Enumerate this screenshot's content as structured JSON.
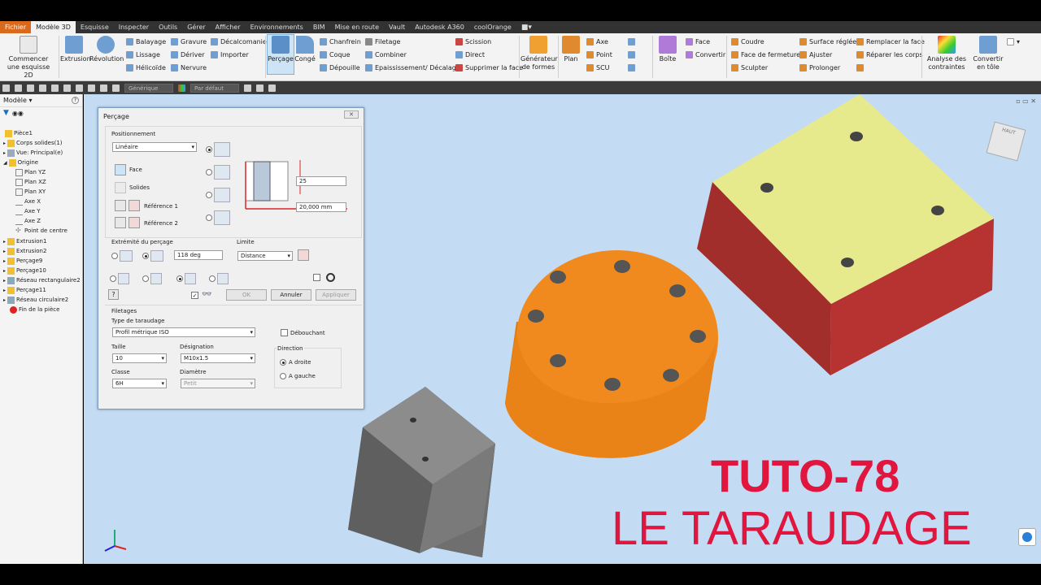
{
  "tabs": [
    "Fichier",
    "Modèle 3D",
    "Esquisse",
    "Inspecter",
    "Outils",
    "Gérer",
    "Afficher",
    "Environnements",
    "BIM",
    "Mise en route",
    "Vault",
    "Autodesk A360",
    "coolOrange"
  ],
  "ribbon": {
    "start_sketch": "Commencer une esquisse 2D",
    "extrusion": "Extrusion",
    "revolution": "Révolution",
    "balayage": "Balayage",
    "lissage": "Lissage",
    "helicoide": "Hélicoïde",
    "gravure": "Gravure",
    "deriver": "Dériver",
    "nervure": "Nervure",
    "decalcomanie": "Décalcomanie",
    "importer": "Importer",
    "percage": "Perçage",
    "conge": "Congé",
    "chanfrein": "Chanfrein",
    "coque": "Coque",
    "depouille": "Dépouille",
    "filetage": "Filetage",
    "combiner": "Combiner",
    "epaississement": "Epaississement/ Décalage",
    "scission": "Scission",
    "direct": "Direct",
    "supprimer_face": "Supprimer la face",
    "generateur_formes": "Générateur de formes",
    "plan": "Plan",
    "axe": "Axe",
    "point": "Point",
    "scu": "SCU",
    "boite": "Boîte",
    "face": "Face",
    "convertir": "Convertir",
    "coudre": "Coudre",
    "face_fermeture": "Face de fermeture",
    "sculpter": "Sculpter",
    "surface_reglee": "Surface réglée",
    "ajuster": "Ajuster",
    "prolonger": "Prolonger",
    "remplacer_face": "Remplacer la face",
    "reparer_corps": "Réparer les corps",
    "analyse_contraintes": "Analyse des contraintes",
    "convertir_tole": "Convertir en tôle"
  },
  "qat": {
    "material": "Générique",
    "appearance": "Par défaut"
  },
  "browser": {
    "header": "Modèle",
    "items": [
      "Pièce1",
      "Corps solides(1)",
      "Vue: Principal(e)",
      "Origine",
      "Plan YZ",
      "Plan XZ",
      "Plan XY",
      "Axe X",
      "Axe Y",
      "Axe Z",
      "Point de centre",
      "Extrusion1",
      "Extrusion2",
      "Perçage9",
      "Perçage10",
      "Réseau rectangulaire2",
      "Perçage11",
      "Réseau circulaire2",
      "Fin de la pièce"
    ]
  },
  "dialog": {
    "title": "Perçage",
    "positionnement": "Positionnement",
    "positionnement_value": "Linéaire",
    "face": "Face",
    "solides": "Solides",
    "reference1": "Référence 1",
    "reference2": "Référence 2",
    "depth_value": "25",
    "diameter_value": "20,000 mm",
    "extremite": "Extrémité du perçage",
    "angle_value": "118 deg",
    "limite": "Limite",
    "limite_value": "Distance",
    "ok": "OK",
    "annuler": "Annuler",
    "appliquer": "Appliquer",
    "filetages": "Filetages",
    "type_taraudage": "Type de taraudage",
    "type_taraudage_value": "Profil métrique ISO",
    "debouchant": "Débouchant",
    "taille": "Taille",
    "taille_value": "10",
    "designation": "Désignation",
    "designation_value": "M10x1.5",
    "classe": "Classe",
    "classe_value": "6H",
    "diametre": "Diamètre",
    "diametre_value": "Petit",
    "direction": "Direction",
    "a_droite": "A droite",
    "a_gauche": "A gauche"
  },
  "viewcube_label": "HAUT",
  "overlay": {
    "line1": "TUTO-78",
    "line2": "LE TARAUDAGE"
  },
  "colors": {
    "accent": "#e0163f",
    "cylinder": "#f08a1e",
    "box_top": "#e7ea8c",
    "box_side": "#a22e2c",
    "cube": "#7a7a7a",
    "viewport": "#c3dbf3"
  }
}
